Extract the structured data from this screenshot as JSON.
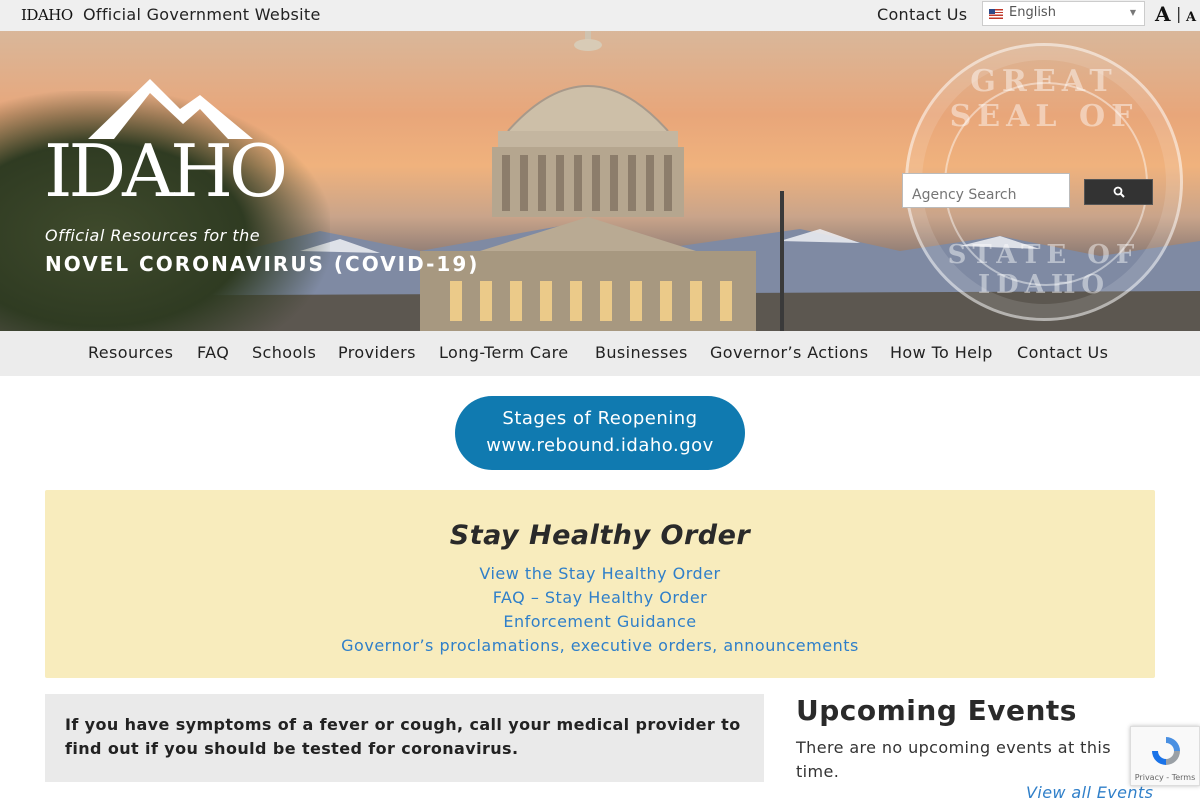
{
  "topbar": {
    "mini_logo": "IDAHO",
    "official": "Official Government Website",
    "contact": "Contact Us",
    "language": "English",
    "font_large": "A",
    "font_separator": "|",
    "font_small": "A"
  },
  "hero": {
    "logo_word": "IDAHO",
    "subtitle_italic": "Official Resources for the",
    "subtitle_bold": "NOVEL CORONAVIRUS (COVID-19)",
    "seal_top": "GREAT SEAL OF",
    "seal_bottom": "STATE OF IDAHO",
    "search_placeholder": "Agency Search"
  },
  "nav": {
    "items": [
      {
        "label": "Resources"
      },
      {
        "label": "FAQ"
      },
      {
        "label": "Schools"
      },
      {
        "label": "Providers"
      },
      {
        "label": "Long-Term Care"
      },
      {
        "label": "Businesses"
      },
      {
        "label": "Governor’s Actions"
      },
      {
        "label": "How To Help"
      },
      {
        "label": "Contact Us"
      }
    ]
  },
  "reopen": {
    "line1": "Stages of Reopening",
    "line2": "www.rebound.idaho.gov"
  },
  "stay_healthy": {
    "title": "Stay Healthy Order",
    "links": [
      "View the Stay Healthy Order",
      "FAQ – Stay Healthy Order",
      "Enforcement Guidance",
      "Governor’s proclamations, executive orders, announcements"
    ]
  },
  "symptom_notice": "If you have symptoms of a fever or cough, call your medical provider to find out if you should be tested for coronavirus.",
  "events": {
    "title": "Upcoming Events",
    "none": "There are no upcoming events at this time.",
    "view_all": "View all Events"
  },
  "recaptcha": {
    "text": "Privacy - Terms"
  },
  "colors": {
    "accent_blue": "#107ab0",
    "link_blue": "#2f7fc9",
    "notice_yellow": "#f8ecbd"
  }
}
